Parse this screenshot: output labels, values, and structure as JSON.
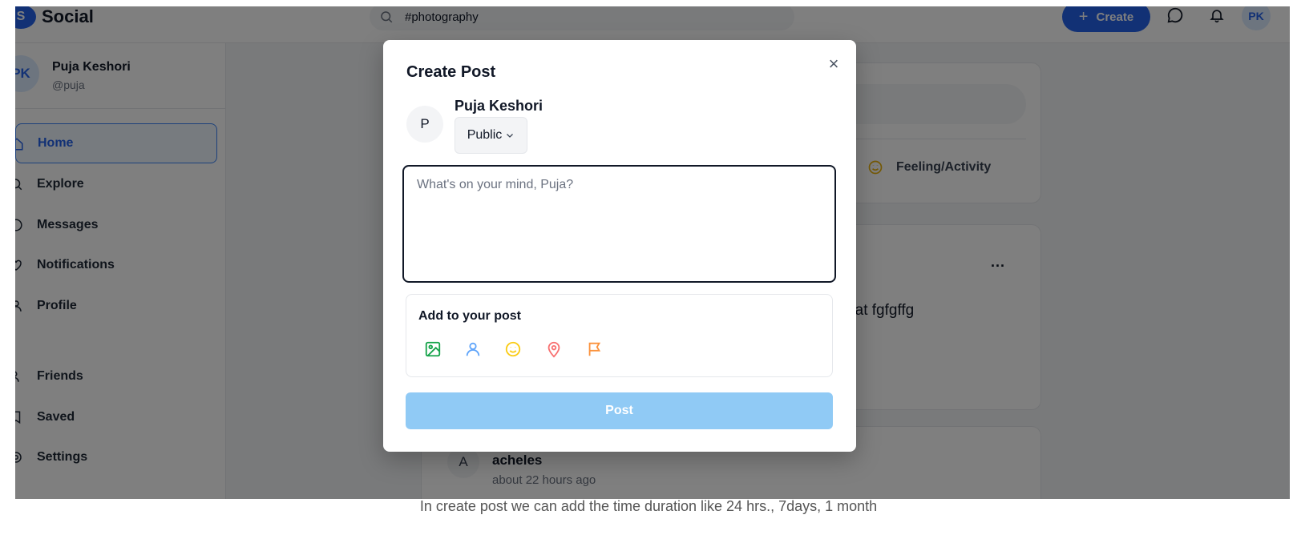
{
  "app": {
    "logo_letter": "S",
    "name": "Social"
  },
  "header": {
    "search_value": "#photography",
    "create_label": "Create",
    "avatar_initials": "PK",
    "icons": [
      "search-icon",
      "plus-icon",
      "message-icon",
      "bell-icon"
    ]
  },
  "sidebar": {
    "profile": {
      "initials": "PK",
      "name": "Puja Keshori",
      "handle": "@puja"
    },
    "items": [
      {
        "label": "Home",
        "icon": "home-icon",
        "active": true
      },
      {
        "label": "Explore",
        "icon": "search-icon",
        "active": false
      },
      {
        "label": "Messages",
        "icon": "message-icon",
        "active": false
      },
      {
        "label": "Notifications",
        "icon": "heart-icon",
        "active": false
      },
      {
        "label": "Profile",
        "icon": "user-icon",
        "active": false
      },
      {
        "label": "Friends",
        "icon": "users-icon",
        "active": false
      },
      {
        "label": "Saved",
        "icon": "bookmark-icon",
        "active": false
      },
      {
        "label": "Settings",
        "icon": "gear-icon",
        "active": false
      }
    ]
  },
  "feed": {
    "composer": {
      "feeling_label": "Feeling/Activity"
    },
    "post": {
      "text_fragment": "ing at fgfgffg",
      "more": "..."
    },
    "post2": {
      "avatar_letter": "A",
      "author": "acheles",
      "time": "about 22 hours ago"
    }
  },
  "modal": {
    "title": "Create Post",
    "close_symbol": "×",
    "avatar_letter": "P",
    "author": "Puja Keshori",
    "audience": "Public",
    "placeholder": "What's on your mind, Puja?",
    "add_label": "Add to your post",
    "add_icons": [
      {
        "name": "image-icon",
        "color": "#16a34a"
      },
      {
        "name": "tag-user-icon",
        "color": "#60a5fa"
      },
      {
        "name": "smiley-icon",
        "color": "#facc15"
      },
      {
        "name": "location-pin-icon",
        "color": "#f87171"
      },
      {
        "name": "flag-icon",
        "color": "#fb923c"
      }
    ],
    "post_label": "Post"
  },
  "caption": "In create post we can add the time duration like 24 hrs., 7days, 1 month",
  "colors": {
    "primary": "#2563eb",
    "post_button_disabled": "#90caf5",
    "overlay": "rgba(0,0,0,0.5)"
  }
}
